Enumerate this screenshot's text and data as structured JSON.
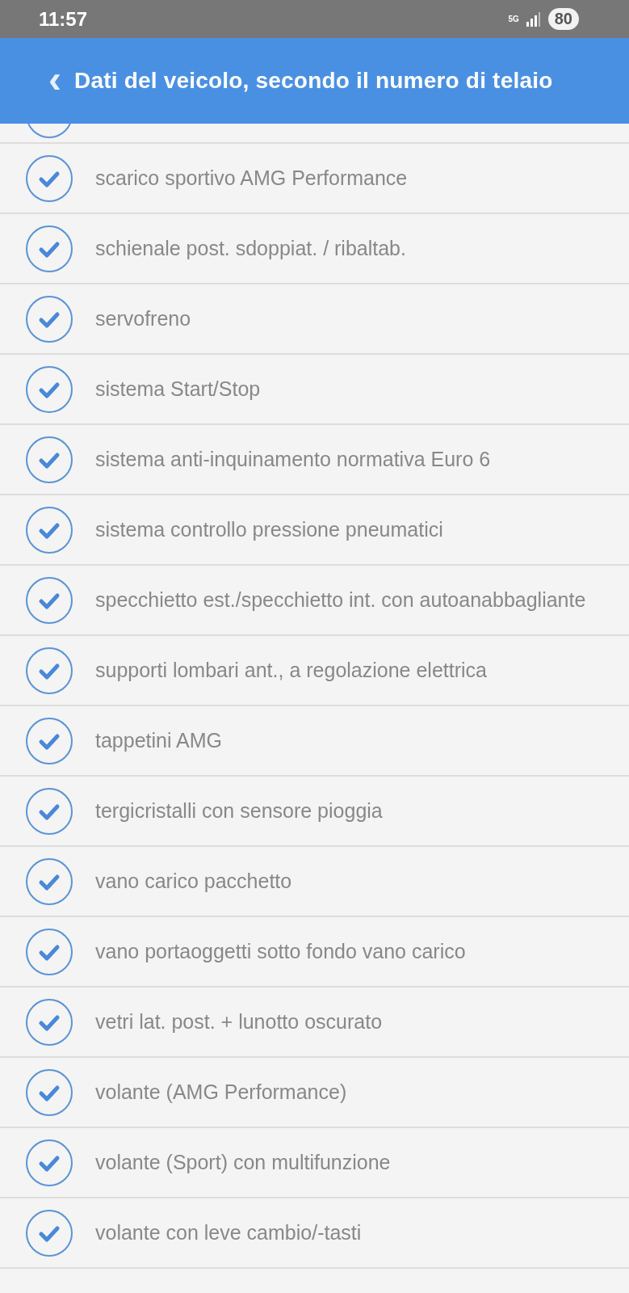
{
  "status_bar": {
    "time": "11:57",
    "network": "5G",
    "battery": "80"
  },
  "header": {
    "back": "‹",
    "title": "Dati del veicolo, secondo il numero di telaio"
  },
  "items": [
    {
      "label": "scarico sportivo AMG Performance",
      "checked": true
    },
    {
      "label": "schienale post. sdoppiat. / ribaltab.",
      "checked": true
    },
    {
      "label": "servofreno",
      "checked": true
    },
    {
      "label": "sistema Start/Stop",
      "checked": true
    },
    {
      "label": "sistema anti-inquinamento normativa Euro 6",
      "checked": true
    },
    {
      "label": "sistema controllo pressione pneumatici",
      "checked": true
    },
    {
      "label": "specchietto est./specchietto int. con autoanabbagliante",
      "checked": true
    },
    {
      "label": "supporti lombari ant., a regolazione elettrica",
      "checked": true
    },
    {
      "label": "tappetini AMG",
      "checked": true
    },
    {
      "label": "tergicristalli con sensore pioggia",
      "checked": true
    },
    {
      "label": "vano carico pacchetto",
      "checked": true
    },
    {
      "label": "vano portaoggetti sotto fondo vano carico",
      "checked": true
    },
    {
      "label": "vetri lat. post. + lunotto oscurato",
      "checked": true
    },
    {
      "label": "volante (AMG Performance)",
      "checked": true
    },
    {
      "label": "volante (Sport) con multifunzione",
      "checked": true
    },
    {
      "label": "volante con leve cambio/-tasti",
      "checked": true
    }
  ]
}
